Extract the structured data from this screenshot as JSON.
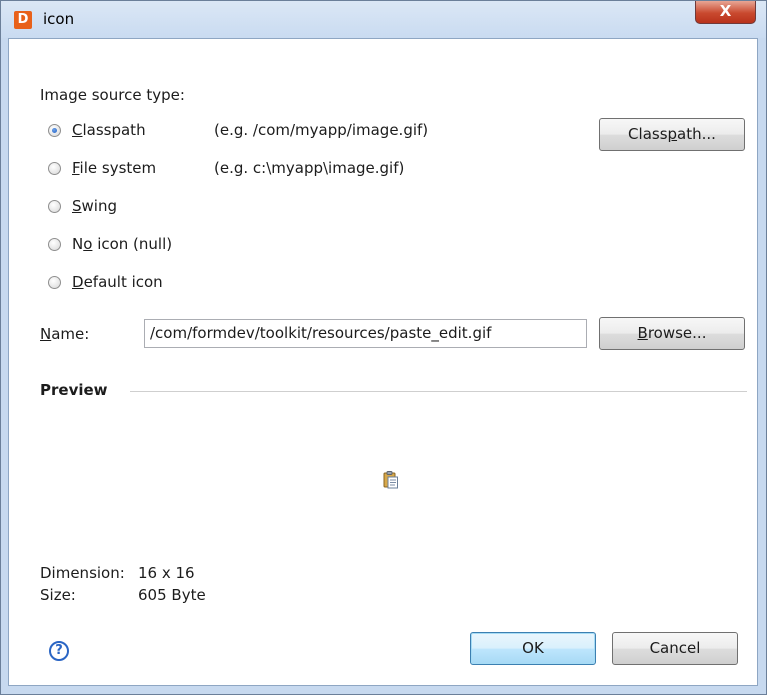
{
  "window": {
    "title": "icon",
    "app_icon_glyph": "D",
    "close_glyph": "X"
  },
  "source": {
    "label": "Image source type:",
    "options": [
      {
        "mn": "C",
        "rest": "lasspath",
        "example": "(e.g. /com/myapp/image.gif)",
        "checked": true
      },
      {
        "mn": "F",
        "rest": "ile system",
        "example": "(e.g. c:\\myapp\\image.gif)",
        "checked": false
      },
      {
        "mn": "S",
        "rest": "wing",
        "checked": false
      },
      {
        "pre": "N",
        "mn": "o",
        "rest": " icon (null)",
        "checked": false
      },
      {
        "mn": "D",
        "rest": "efault icon",
        "checked": false
      }
    ],
    "classpath_button": {
      "pre": "Class",
      "mn": "p",
      "rest": "ath..."
    }
  },
  "name": {
    "label_mn": "N",
    "label_rest": "ame:",
    "value": "/com/formdev/toolkit/resources/paste_edit.gif",
    "browse": {
      "mn": "B",
      "rest": "rowse..."
    }
  },
  "preview": {
    "title": "Preview",
    "icon": "paste-edit-icon",
    "dimension_label": "Dimension:",
    "dimension_value": "16 x 16",
    "size_label": "Size:",
    "size_value": "605 Byte"
  },
  "footer": {
    "help_icon": "help-icon",
    "help_glyph": "?",
    "ok": "OK",
    "cancel": "Cancel"
  },
  "colors": {
    "accent": "#1e5fc7",
    "close": "#c9492f",
    "app_icon": "#e8611a"
  }
}
